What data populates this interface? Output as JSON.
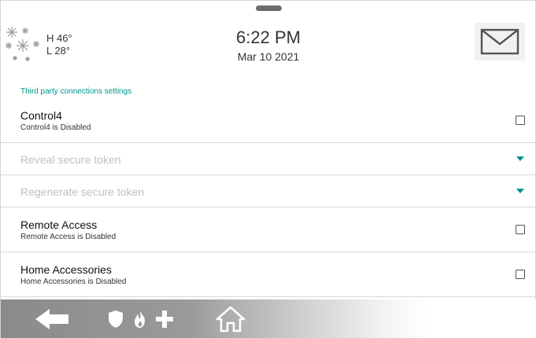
{
  "header": {
    "weather": {
      "high": "H 46°",
      "low": "L 28°",
      "icon": "snow-icon"
    },
    "time": "6:22 PM",
    "date": "Mar 10 2021",
    "mail_icon": "mail-icon"
  },
  "section": {
    "title": "Third party connections settings"
  },
  "settings": {
    "control4": {
      "title": "Control4",
      "status": "Control4 is Disabled"
    },
    "reveal_token": {
      "label": "Reveal secure token"
    },
    "regenerate_token": {
      "label": "Regenerate secure token"
    },
    "remote_access": {
      "title": "Remote Access",
      "status": "Remote Access is Disabled"
    },
    "home_accessories": {
      "title": "Home Accessories",
      "status": "Home Accessories is Disabled"
    }
  },
  "footer": {
    "icons": [
      "back-arrow-icon",
      "shield-icon",
      "fire-icon",
      "medical-cross-icon",
      "home-icon"
    ]
  },
  "colors": {
    "accent": "#00958a",
    "footer_dark": "#8a8a8a",
    "text": "#111111"
  }
}
